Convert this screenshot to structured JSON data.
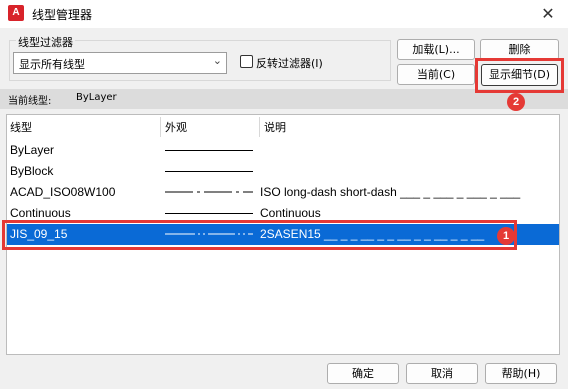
{
  "window": {
    "title": "线型管理器",
    "close_glyph": "✕",
    "app_icon_text": "A"
  },
  "filter": {
    "group_label": "线型过滤器",
    "selected": "显示所有线型",
    "invert_label": "反转过滤器(I)",
    "invert_checked": false
  },
  "buttons": {
    "load": "加载(L)...",
    "delete": "删除",
    "current": "当前(C)",
    "show_details": "显示细节(D)",
    "ok": "确定",
    "cancel": "取消",
    "help": "帮助(H)"
  },
  "current_linetype": {
    "label": "当前线型:",
    "value": "ByLayer"
  },
  "table": {
    "headers": [
      "线型",
      "外观",
      "说明"
    ],
    "rows": [
      {
        "name": "ByLayer",
        "appearance": "solid",
        "description": ""
      },
      {
        "name": "ByBlock",
        "appearance": "solid",
        "description": ""
      },
      {
        "name": "ACAD_ISO08W100",
        "appearance": "long-dash-short-dash",
        "description": "ISO long-dash short-dash ___ _ ___ _ ___ _ ___"
      },
      {
        "name": "Continuous",
        "appearance": "solid",
        "description": "Continuous"
      },
      {
        "name": "JIS_09_15",
        "appearance": "jis-dash",
        "description": "2SASEN15 __ _ _ __ _ _ __ _ _ __ _ _ __",
        "selected": true
      }
    ]
  },
  "annotations": {
    "badge_row": "1",
    "badge_details": "2",
    "highlight_color": "#e53935"
  },
  "colors": {
    "selection": "#0a6ad6",
    "accent": "#d8232a"
  }
}
